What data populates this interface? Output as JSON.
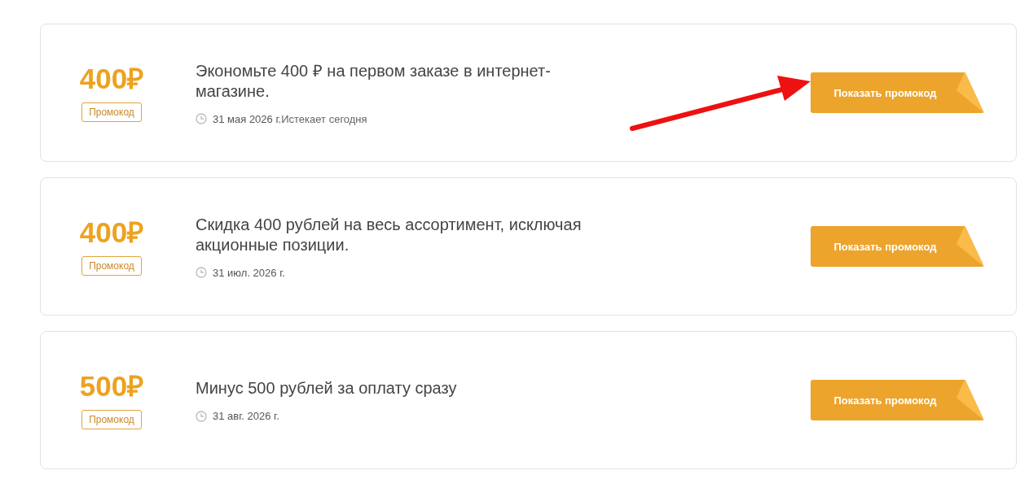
{
  "coupons": [
    {
      "amount": "400₽",
      "tag": "Промокод",
      "title": "Экономьте 400 ₽ на первом заказе в интернет-магазине.",
      "date": "31 мая 2026 г.",
      "note": "Истекает сегодня",
      "button": "Показать промокод"
    },
    {
      "amount": "400₽",
      "tag": "Промокод",
      "title": "Скидка 400 рублей на весь ассортимент, исключая акционные позиции.",
      "date": "31 июл. 2026 г.",
      "button": "Показать промокод"
    },
    {
      "amount": "500₽",
      "tag": "Промокод",
      "title": "Минус 500 рублей за оплату сразу",
      "date": "31 авг. 2026 г.",
      "button": "Показать промокод"
    }
  ]
}
